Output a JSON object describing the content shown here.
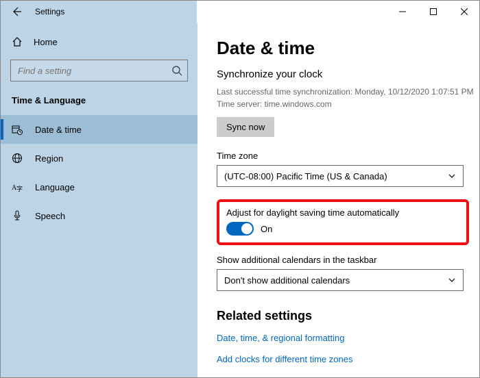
{
  "window": {
    "title": "Settings"
  },
  "sidebar": {
    "home": "Home",
    "search_placeholder": "Find a setting",
    "section": "Time & Language",
    "items": [
      {
        "label": "Date & time"
      },
      {
        "label": "Region"
      },
      {
        "label": "Language"
      },
      {
        "label": "Speech"
      }
    ]
  },
  "main": {
    "title": "Date & time",
    "sync_head": "Synchronize your clock",
    "last_sync": "Last successful time synchronization: Monday, 10/12/2020 1:07:51 PM",
    "time_server": "Time server: time.windows.com",
    "sync_button": "Sync now",
    "tz_label": "Time zone",
    "tz_value": "(UTC-08:00) Pacific Time (US & Canada)",
    "dst_label": "Adjust for daylight saving time automatically",
    "dst_state": "On",
    "addcal_label": "Show additional calendars in the taskbar",
    "addcal_value": "Don't show additional calendars",
    "related_head": "Related settings",
    "link1": "Date, time, & regional formatting",
    "link2": "Add clocks for different time zones"
  }
}
